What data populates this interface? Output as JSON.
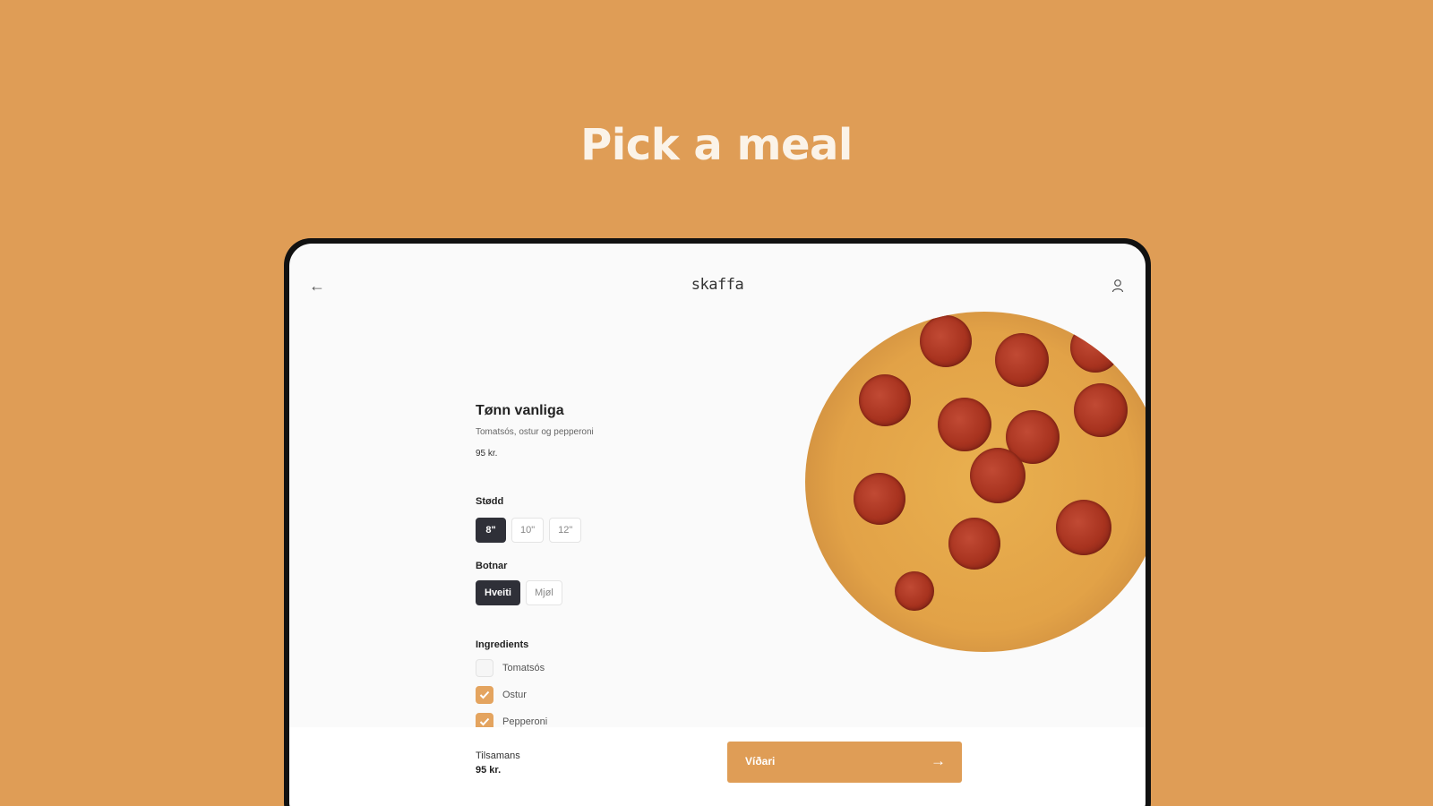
{
  "headline": "Pick a meal",
  "app": {
    "brand": "skaffa",
    "icons": {
      "back": "arrow-left-icon",
      "user": "user-icon"
    }
  },
  "product": {
    "name": "Tønn vanliga",
    "description": "Tomatsós, ostur og pepperoni",
    "price": "95 kr."
  },
  "options": {
    "size": {
      "label": "Stødd",
      "choices": [
        "8\"",
        "10\"",
        "12\""
      ],
      "selected": "8\""
    },
    "base": {
      "label": "Botnar",
      "choices": [
        "Hveiti",
        "Mjøl"
      ],
      "selected": "Hveiti"
    }
  },
  "ingredients": {
    "label": "Ingredients",
    "items": [
      {
        "name": "Tomatsós",
        "checked": false
      },
      {
        "name": "Ostur",
        "checked": true
      },
      {
        "name": "Pepperoni",
        "checked": true
      }
    ]
  },
  "footer": {
    "total_label": "Tilsamans",
    "total_value": "95 kr.",
    "next_label": "Víðari",
    "next_icon": "arrow-right-icon"
  },
  "colors": {
    "background": "#DF9D56",
    "accent": "#DF9D56",
    "chip_selected": "#2F3038"
  }
}
